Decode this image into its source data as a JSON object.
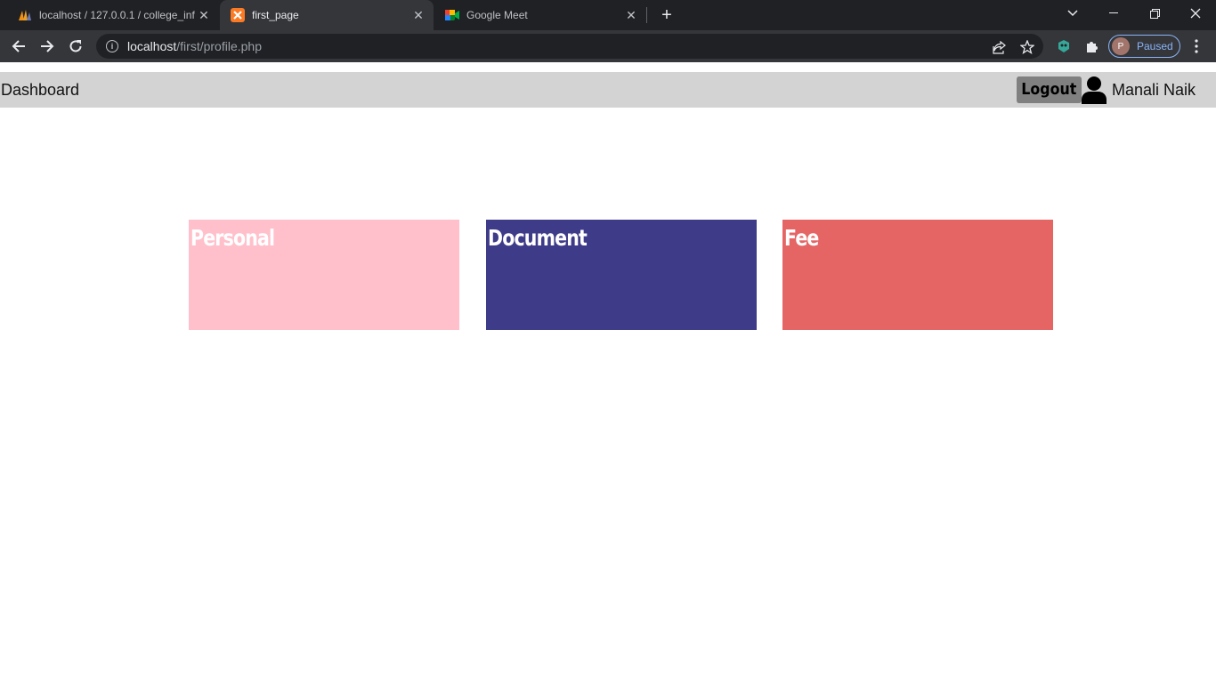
{
  "browser": {
    "tabs": [
      {
        "title": "localhost / 127.0.0.1 / college_inf",
        "favicon": "phpmyadmin-icon",
        "active": false
      },
      {
        "title": "first_page",
        "favicon": "xampp-icon",
        "active": true
      },
      {
        "title": "Google Meet",
        "favicon": "google-meet-icon",
        "active": false
      }
    ],
    "close_glyph": "✕",
    "new_tab_glyph": "+",
    "url_host": "localhost",
    "url_path": "/first/profile.php",
    "profile_initial": "P",
    "profile_status": "Paused"
  },
  "nav": {
    "brand": "Dashboard",
    "logout_label": "Logout",
    "user_name": "Manali Naik"
  },
  "cards": [
    {
      "label": "Personal",
      "color": "#ffc0cb"
    },
    {
      "label": "Document",
      "color": "#3e3b88"
    },
    {
      "label": "Fee",
      "color": "#e56565"
    }
  ],
  "colors": {
    "navbar_bg": "#d3d3d3",
    "logout_bg": "#808080",
    "chrome_dark": "#202124",
    "chrome_toolbar": "#35363a"
  }
}
